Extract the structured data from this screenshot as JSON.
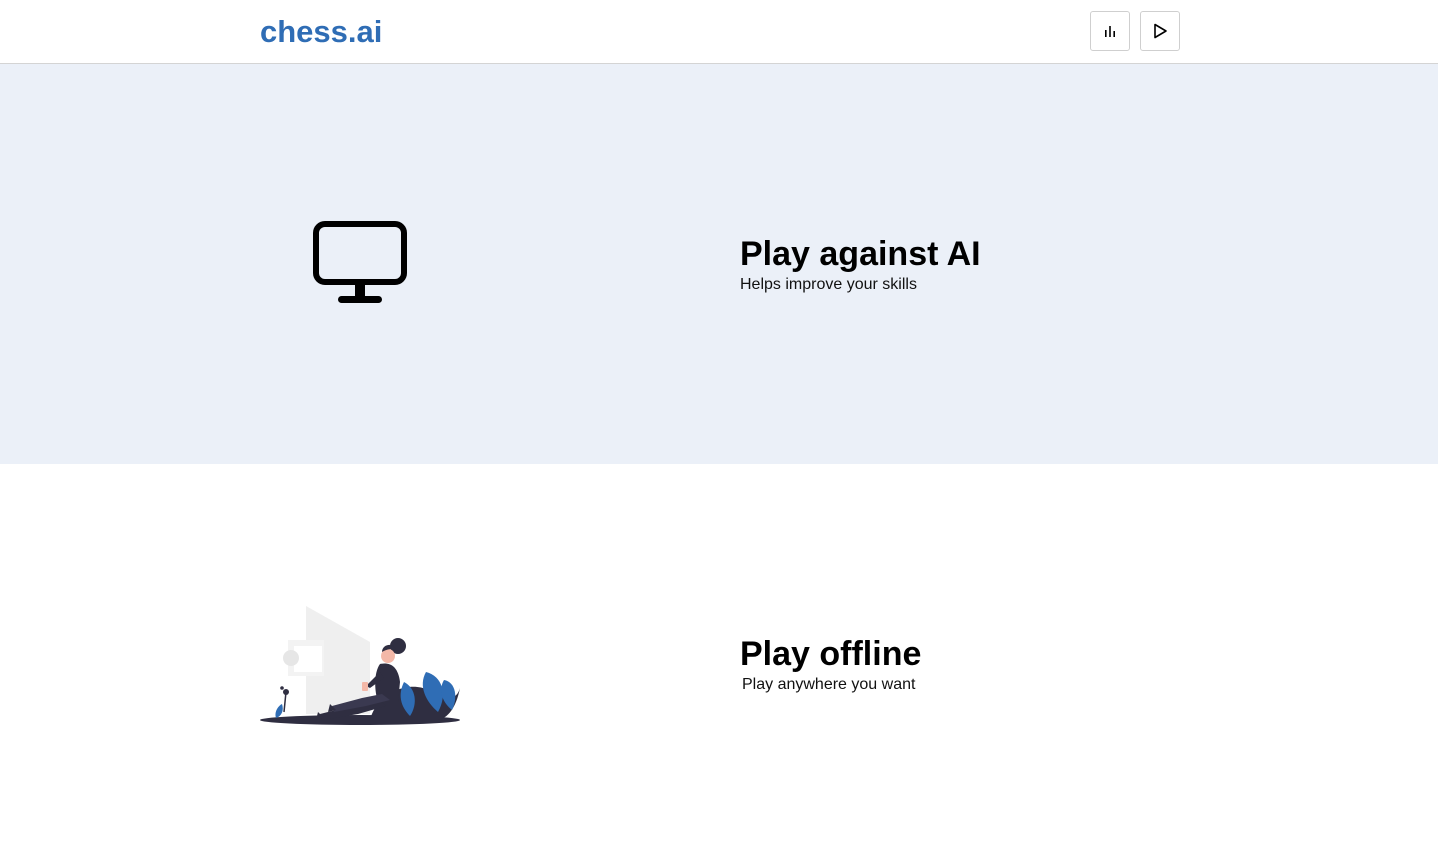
{
  "header": {
    "brand": "chess.ai",
    "buttons": [
      {
        "icon": "bar-chart-icon"
      },
      {
        "icon": "play-icon"
      }
    ]
  },
  "features": [
    {
      "title": "Play against AI",
      "subtitle": "Helps improve your skills",
      "icon": "monitor-icon",
      "background": "#ebf0f8"
    },
    {
      "title": "Play offline",
      "subtitle": "Play anywhere you want",
      "icon": "person-reading-illustration",
      "background": "#ffffff"
    }
  ],
  "colors": {
    "brand": "#2f6db5",
    "accent_blue": "#2f6db5",
    "illustration_dark": "#2f2e41"
  }
}
